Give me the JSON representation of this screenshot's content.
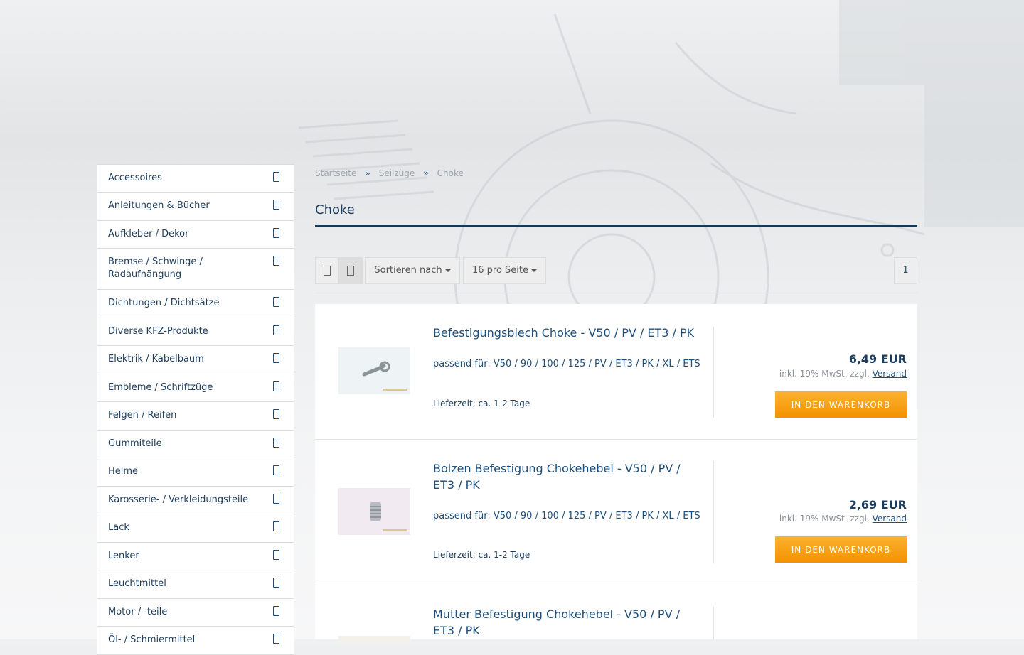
{
  "breadcrumb": {
    "items": [
      "Startseite",
      "Seilzüge",
      "Choke"
    ],
    "separator": "»"
  },
  "page_title": "Choke",
  "toolbar": {
    "sort_label": "Sortieren nach",
    "per_page_label": "16 pro Seite",
    "page_number": "1"
  },
  "sidebar": {
    "items": [
      {
        "label": "Accessoires"
      },
      {
        "label": "Anleitungen & Bücher"
      },
      {
        "label": "Aufkleber / Dekor"
      },
      {
        "label": "Bremse / Schwinge / Radaufhängung"
      },
      {
        "label": "Dichtungen / Dichtsätze"
      },
      {
        "label": "Diverse KFZ-Produkte"
      },
      {
        "label": "Elektrik / Kabelbaum"
      },
      {
        "label": "Embleme / Schriftzüge"
      },
      {
        "label": "Felgen / Reifen"
      },
      {
        "label": "Gummiteile"
      },
      {
        "label": "Helme"
      },
      {
        "label": "Karosserie- / Verkleidungsteile"
      },
      {
        "label": "Lack"
      },
      {
        "label": "Lenker"
      },
      {
        "label": "Leuchtmittel"
      },
      {
        "label": "Motor / -teile"
      },
      {
        "label": "Öl- / Schmiermittel"
      }
    ]
  },
  "products": [
    {
      "name": "Befestigungsblech Choke - V50 / PV / ET3 / PK",
      "fits": "passend für: V50 / 90 / 100 / 125 / PV / ET3 / PK / XL / ETS",
      "delivery": "Lieferzeit: ca. 1-2 Tage",
      "price": "6,49 EUR",
      "tax_text": "inkl. 19% MwSt. zzgl.",
      "shipping_link": "Versand",
      "cart_label": "IN DEN WARENKORB"
    },
    {
      "name": "Bolzen Befestigung Chokehebel - V50 / PV / ET3 / PK",
      "fits": "passend für: V50 / 90 / 100 / 125 / PV / ET3 / PK / XL / ETS",
      "delivery": "Lieferzeit: ca. 1-2 Tage",
      "price": "2,69 EUR",
      "tax_text": "inkl. 19% MwSt. zzgl.",
      "shipping_link": "Versand",
      "cart_label": "IN DEN WARENKORB"
    },
    {
      "name": "Mutter Befestigung Chokehebel - V50 / PV / ET3 / PK"
    }
  ],
  "icons": {
    "view_grid": "grid-view-icon",
    "view_list": "list-view-icon",
    "chevron": "chevron-right-icon"
  },
  "colors": {
    "accent": "#123a5c",
    "link": "#1d4e7a",
    "cart_button": "#f39200"
  }
}
